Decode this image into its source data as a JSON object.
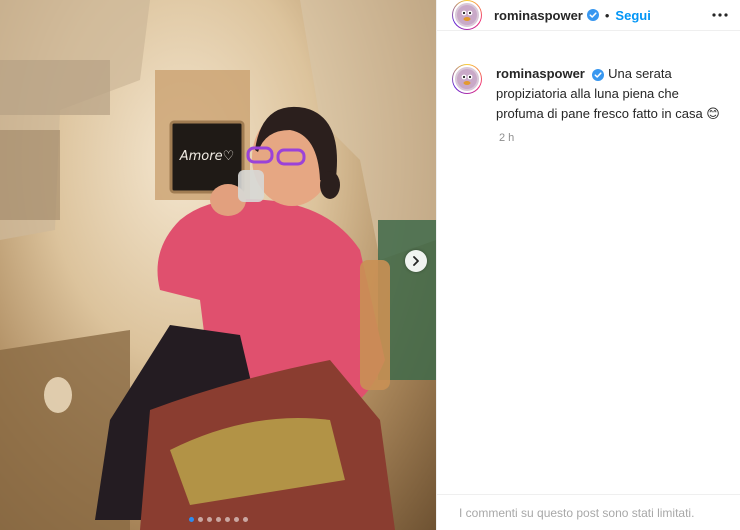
{
  "post": {
    "carousel": {
      "slide_count": 7,
      "active_index": 0,
      "next_icon": "chevron-right-icon",
      "chalkboard_text": "Amore♡"
    },
    "author": {
      "username": "rominaspower",
      "verified": true,
      "verified_icon": "verified-badge-icon",
      "separator": "•",
      "follow_label": "Segui",
      "more_icon": "more-horizontal-icon"
    },
    "caption": {
      "username": "rominaspower",
      "text": "Una serata propiziatoria alla luna piena che profuma di pane fresco fatto in casa 😊"
    },
    "timestamp": "2 h",
    "comments_notice": "I commenti su questo post sono stati limitati."
  },
  "colors": {
    "accent": "#0095f6",
    "verified": "#3897f0",
    "text": "#262626",
    "muted": "#8e8e8e"
  }
}
